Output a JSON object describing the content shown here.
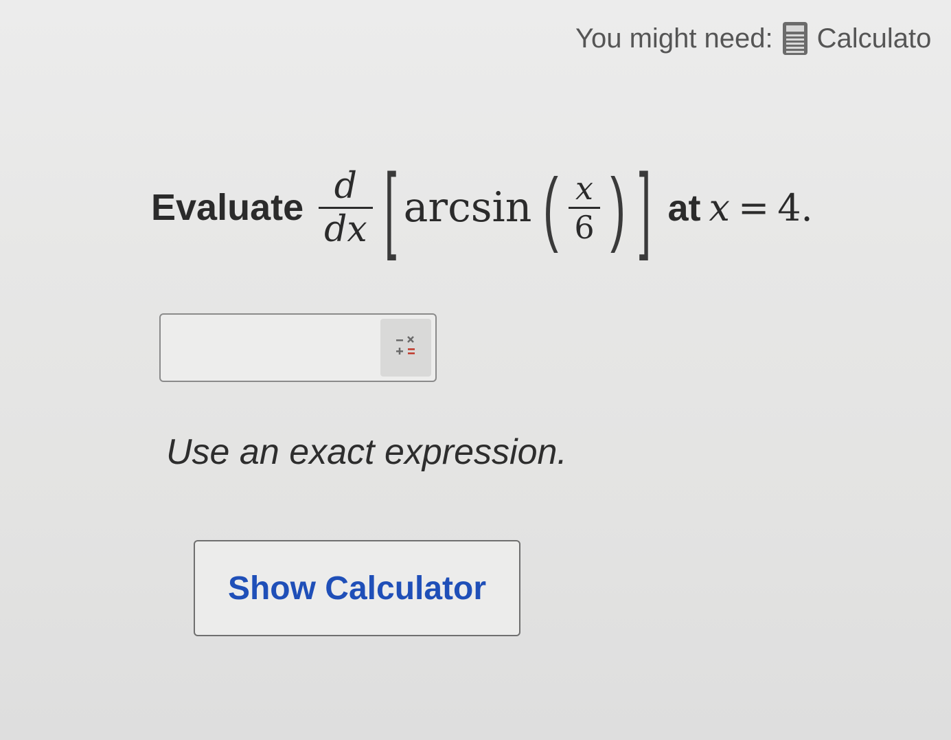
{
  "header": {
    "need_label": "You might need:",
    "calculator_link": "Calculato",
    "calculator_icon": "calculator-icon"
  },
  "problem": {
    "prefix": "Evaluate",
    "derivative_num": "d",
    "derivative_den": "dx",
    "function_name": "arcsin",
    "arg_num": "x",
    "arg_den": "6",
    "at_word": "at",
    "var": "x",
    "equals": "=",
    "value": "4."
  },
  "answer": {
    "value": "",
    "placeholder": "",
    "keypad_icon": "math-keypad-icon"
  },
  "instruction": "Use an exact expression.",
  "show_calculator_label": "Show Calculator",
  "colors": {
    "link_blue": "#1f4fb8",
    "background": "#e7e7e6",
    "keypad_red": "#c0392b"
  }
}
